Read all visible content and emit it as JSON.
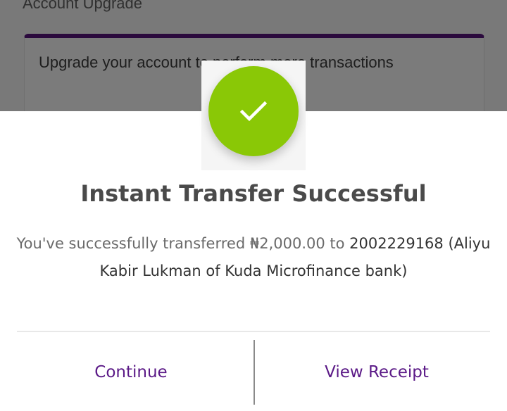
{
  "background": {
    "section_title": "Account Upgrade",
    "card_text": "Upgrade your account to perform more transactions"
  },
  "dialog": {
    "icon": "check-icon",
    "title": "Instant Transfer Successful",
    "message_prefix": "You've successfully transferred ",
    "amount": "₦2,000.00",
    "message_to": " to ",
    "recipient": "2002229168 (Aliyu Kabir Lukman of Kuda Microfinance bank)",
    "continue_label": "Continue",
    "view_receipt_label": "View Receipt"
  },
  "colors": {
    "success_green": "#8ac806",
    "action_purple": "#5b1a87",
    "card_accent": "#2b0a3d"
  }
}
